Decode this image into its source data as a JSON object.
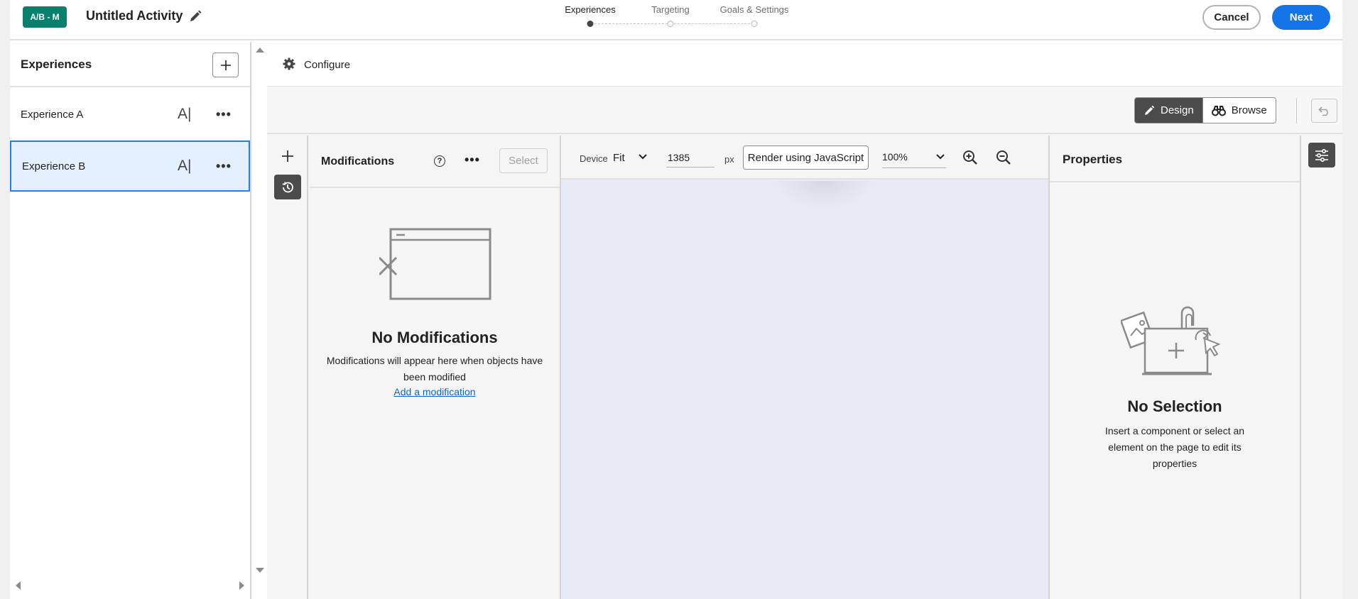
{
  "header": {
    "badge": "A/B - M",
    "activity_title": "Untitled Activity",
    "steps": [
      {
        "label": "Experiences",
        "active": true
      },
      {
        "label": "Targeting",
        "active": false
      },
      {
        "label": "Goals & Settings",
        "active": false
      }
    ],
    "cancel_label": "Cancel",
    "next_label": "Next",
    "accent_color": "#1473e6",
    "badge_color": "#07806e"
  },
  "experiences": {
    "title": "Experiences",
    "items": [
      {
        "label": "Experience A",
        "ai_icon": "A|",
        "selected": false
      },
      {
        "label": "Experience B",
        "ai_icon": "A|",
        "selected": true
      }
    ]
  },
  "configure": {
    "label": "Configure"
  },
  "mode": {
    "design_label": "Design",
    "browse_label": "Browse",
    "active": "Design"
  },
  "modifications": {
    "title": "Modifications",
    "help_symbol": "?",
    "select_label": "Select",
    "empty_title": "No Modifications",
    "empty_desc": "Modifications will appear here when objects have been modified",
    "add_link": "Add a modification"
  },
  "device": {
    "label": "Device",
    "fit_value": "Fit",
    "width_value": "1385",
    "unit": "px",
    "render_label": "Render using JavaScript",
    "zoom_value": "100%"
  },
  "properties": {
    "title": "Properties",
    "empty_title": "No Selection",
    "empty_desc": "Insert a component or select an element on the page to edit its properties"
  }
}
